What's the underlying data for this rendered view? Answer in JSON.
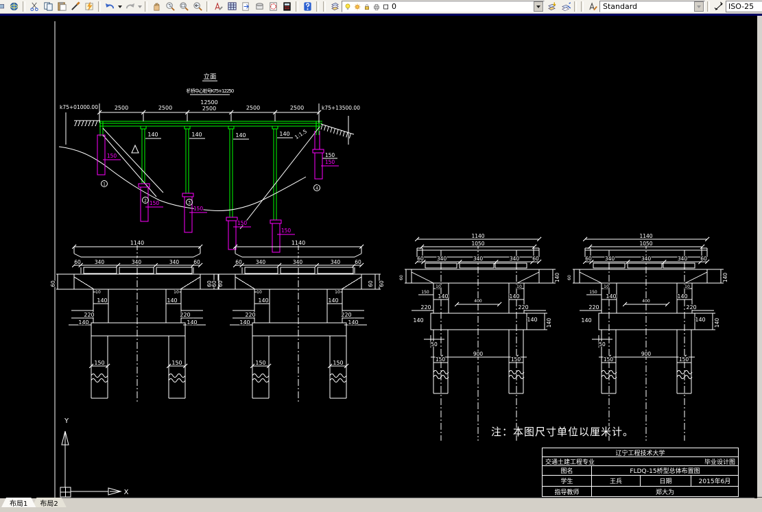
{
  "toolbar": {
    "layer_name": "0",
    "text_style": "Standard",
    "dim_style": "ISO-25",
    "icons": [
      "plot-preview",
      "publish",
      "cut",
      "copy",
      "paste",
      "match-properties",
      "block-editor",
      "undo",
      "undo-dropdown",
      "redo",
      "redo-dropdown",
      "pan",
      "zoom-realtime",
      "zoom-window",
      "zoom-previous",
      "edit-text",
      "design-center",
      "tool-palettes",
      "sheet-set-manager",
      "markup-set-manager",
      "quick-calc",
      "help",
      "layer-properties",
      "layer-visibility-bulb",
      "layer-freeze-sun",
      "layer-lock",
      "layer-plot",
      "layer-color-swatch",
      "layer-dropdown",
      "make-object-layer-current",
      "layer-previous",
      "text-style",
      "style-dropdown",
      "dim-style"
    ]
  },
  "canvas": {
    "elevation": {
      "title": "立面",
      "subtitle": "桥中心桩号K75+12250",
      "station_left": "k75+01000.00",
      "station_right": "k75+13500.00",
      "total": "12500",
      "span": "2500",
      "pier_dim": "140",
      "pile_dim": "150",
      "slope": "1:1.5",
      "marker_1": "1",
      "marker_2": "2",
      "marker_3": "3",
      "marker_4": "4"
    },
    "section": {
      "w_total": "1140",
      "w_clear": "1050",
      "edge": "60",
      "spacing": "340",
      "offset": "10",
      "col": "140",
      "d220": "220",
      "d150": "150",
      "d400": "400",
      "d900": "900",
      "d50": "50"
    },
    "note": "注：本图尺寸单位以厘米计。",
    "ucs": {
      "x": "X",
      "y": "Y"
    }
  },
  "titleblock": {
    "university": "辽宁工程技术大学",
    "major": "交通土建工程专业",
    "doc_type": "毕业设计图",
    "name_label": "图名",
    "drawing_name": "FLDQ-15桥型总体布置图",
    "student_label": "学生",
    "student": "王兵",
    "date_label": "日期",
    "date": "2015年6月",
    "advisor_label": "指导教师",
    "advisor": "郑大为"
  },
  "tabs": {
    "layout1": "布局1",
    "layout2": "布局2"
  }
}
